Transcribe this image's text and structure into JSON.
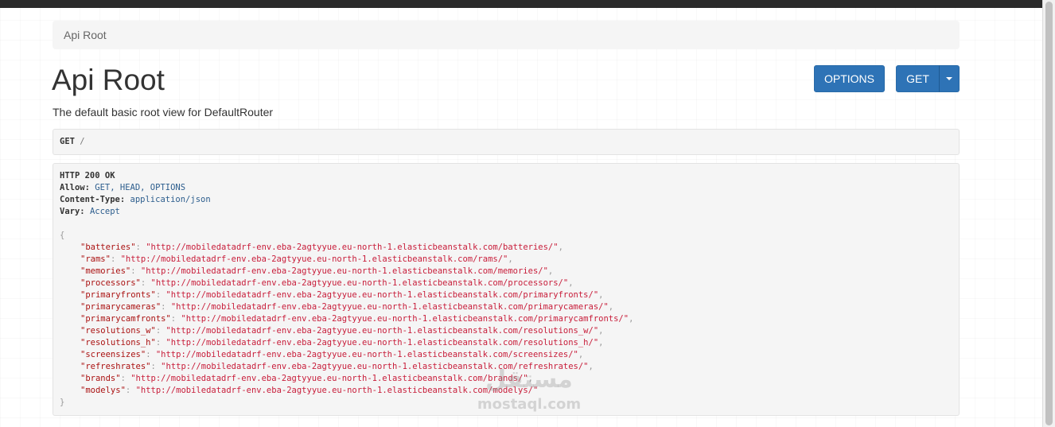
{
  "breadcrumb": {
    "label": "Api Root"
  },
  "page": {
    "title": "Api Root",
    "description": "The default basic root view for DefaultRouter"
  },
  "buttons": {
    "options_label": "OPTIONS",
    "get_label": "GET",
    "caret_icon": "caret-down-icon"
  },
  "request": {
    "method": "GET",
    "path": "/"
  },
  "response": {
    "status": "HTTP 200 OK",
    "headers": [
      {
        "key": "Allow:",
        "value": "GET, HEAD, OPTIONS"
      },
      {
        "key": "Content-Type:",
        "value": "application/json"
      },
      {
        "key": "Vary:",
        "value": "Accept"
      }
    ],
    "open_brace": "{",
    "close_brace": "}",
    "entries": [
      {
        "key": "\"batteries\"",
        "value": "\"http://mobiledatadrf-env.eba-2agtyyue.eu-north-1.elasticbeanstalk.com/batteries/\"",
        "sep": ","
      },
      {
        "key": "\"rams\"",
        "value": "\"http://mobiledatadrf-env.eba-2agtyyue.eu-north-1.elasticbeanstalk.com/rams/\"",
        "sep": ","
      },
      {
        "key": "\"memories\"",
        "value": "\"http://mobiledatadrf-env.eba-2agtyyue.eu-north-1.elasticbeanstalk.com/memories/\"",
        "sep": ","
      },
      {
        "key": "\"processors\"",
        "value": "\"http://mobiledatadrf-env.eba-2agtyyue.eu-north-1.elasticbeanstalk.com/processors/\"",
        "sep": ","
      },
      {
        "key": "\"primaryfronts\"",
        "value": "\"http://mobiledatadrf-env.eba-2agtyyue.eu-north-1.elasticbeanstalk.com/primaryfronts/\"",
        "sep": ","
      },
      {
        "key": "\"primarycameras\"",
        "value": "\"http://mobiledatadrf-env.eba-2agtyyue.eu-north-1.elasticbeanstalk.com/primarycameras/\"",
        "sep": ","
      },
      {
        "key": "\"primarycamfronts\"",
        "value": "\"http://mobiledatadrf-env.eba-2agtyyue.eu-north-1.elasticbeanstalk.com/primarycamfronts/\"",
        "sep": ","
      },
      {
        "key": "\"resolutions_w\"",
        "value": "\"http://mobiledatadrf-env.eba-2agtyyue.eu-north-1.elasticbeanstalk.com/resolutions_w/\"",
        "sep": ","
      },
      {
        "key": "\"resolutions_h\"",
        "value": "\"http://mobiledatadrf-env.eba-2agtyyue.eu-north-1.elasticbeanstalk.com/resolutions_h/\"",
        "sep": ","
      },
      {
        "key": "\"screensizes\"",
        "value": "\"http://mobiledatadrf-env.eba-2agtyyue.eu-north-1.elasticbeanstalk.com/screensizes/\"",
        "sep": ","
      },
      {
        "key": "\"refreshrates\"",
        "value": "\"http://mobiledatadrf-env.eba-2agtyyue.eu-north-1.elasticbeanstalk.com/refreshrates/\"",
        "sep": ","
      },
      {
        "key": "\"brands\"",
        "value": "\"http://mobiledatadrf-env.eba-2agtyyue.eu-north-1.elasticbeanstalk.com/brands/\"",
        "sep": ","
      },
      {
        "key": "\"modelys\"",
        "value": "\"http://mobiledatadrf-env.eba-2agtyyue.eu-north-1.elasticbeanstalk.com/modelys/\"",
        "sep": ""
      }
    ]
  },
  "watermark": {
    "logo": "مستقل",
    "text": "mostaql.com"
  },
  "colors": {
    "button_primary": "#2e73b6",
    "top_bar": "#2b2b2b",
    "json_string": "#c81d3a",
    "header_value": "#2c5d8d"
  }
}
